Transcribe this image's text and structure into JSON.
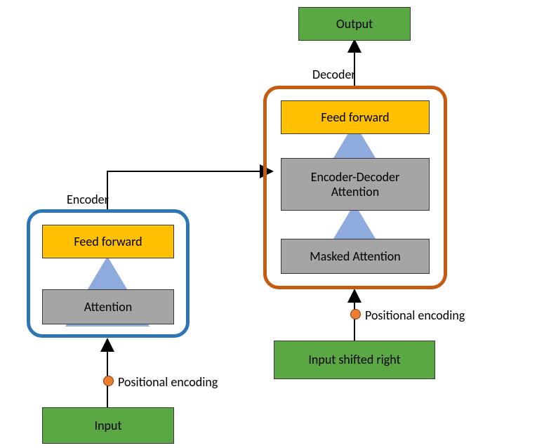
{
  "output": {
    "label": "Output"
  },
  "decoder": {
    "title": "Decoder",
    "feed_forward": "Feed forward",
    "enc_dec_attention": "Encoder-Decoder\nAttention",
    "masked_attention": "Masked Attention",
    "positional_encoding": "Positional encoding",
    "input_shifted": "Input shifted right"
  },
  "encoder": {
    "title": "Encoder",
    "feed_forward": "Feed forward",
    "attention": "Attention",
    "positional_encoding": "Positional encoding",
    "input": "Input"
  },
  "colors": {
    "green": "#59a844",
    "gray": "#a5a5a5",
    "yellow": "#ffc000",
    "encoder_border": "#2e75b6",
    "decoder_border": "#c55a11",
    "arrow_black": "#000000",
    "arrow_blue": "#8faadc",
    "dot": "#ed7d31"
  }
}
